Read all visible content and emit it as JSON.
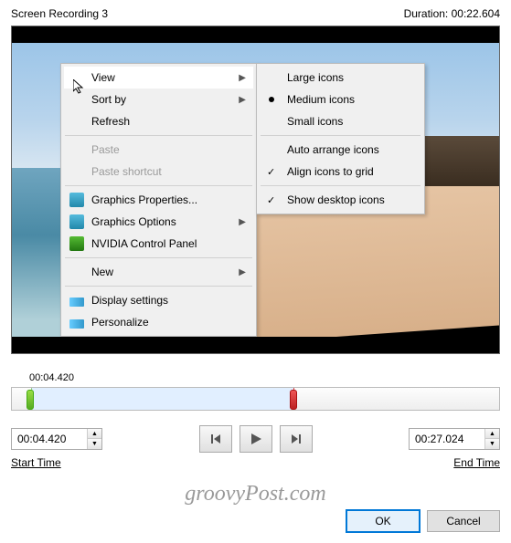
{
  "header": {
    "title": "Screen Recording 3",
    "duration_label": "Duration:",
    "duration_value": "00:22.604"
  },
  "menu1": {
    "items": [
      {
        "label": "View",
        "submenu": true,
        "highlight": true
      },
      {
        "label": "Sort by",
        "submenu": true
      },
      {
        "label": "Refresh"
      }
    ],
    "items2": [
      {
        "label": "Paste",
        "disabled": true
      },
      {
        "label": "Paste shortcut",
        "disabled": true
      }
    ],
    "items3": [
      {
        "label": "Graphics Properties...",
        "icon": "blue"
      },
      {
        "label": "Graphics Options",
        "icon": "blue",
        "submenu": true
      },
      {
        "label": "NVIDIA Control Panel",
        "icon": "green"
      }
    ],
    "items4": [
      {
        "label": "New",
        "submenu": true
      }
    ],
    "items5": [
      {
        "label": "Display settings",
        "icon": "disp"
      },
      {
        "label": "Personalize",
        "icon": "disp"
      }
    ]
  },
  "menu2": {
    "items": [
      {
        "label": "Large icons"
      },
      {
        "label": "Medium icons",
        "radio": true
      },
      {
        "label": "Small icons"
      }
    ],
    "items2": [
      {
        "label": "Auto arrange icons"
      },
      {
        "label": "Align icons to grid",
        "check": true
      }
    ],
    "items3": [
      {
        "label": "Show desktop icons",
        "check": true
      }
    ]
  },
  "timeline": {
    "marker_label": "00:04.420"
  },
  "start": {
    "value": "00:04.420",
    "label": "Start Time"
  },
  "end": {
    "value": "00:27.024",
    "label": "End Time"
  },
  "buttons": {
    "ok": "OK",
    "cancel": "Cancel"
  },
  "watermark": "groovyPost.com"
}
